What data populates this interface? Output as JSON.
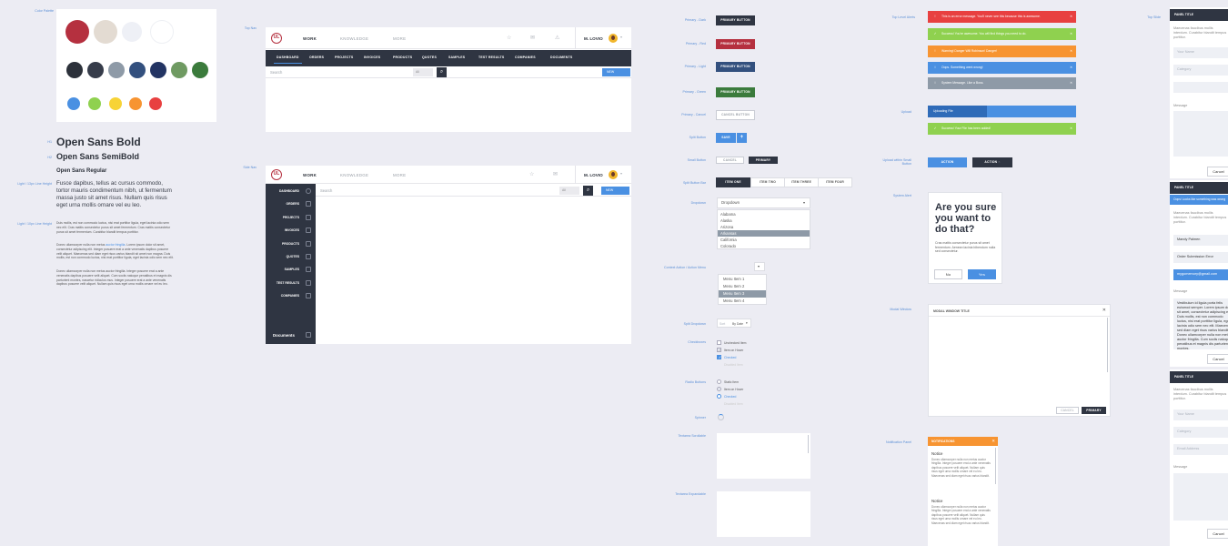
{
  "labels": {
    "color_palette": "Color Palette",
    "h1": "H1",
    "h2": "H2",
    "h3": "",
    "body_large": "Light / 13px Line Height",
    "body_small": "Light / 10px Line Height",
    "top_nav": "Top Nav",
    "side_nav": "Side Nav",
    "primary_dark": "Primary - Dark",
    "primary_red": "Primary - Red",
    "primary_light": "Primary - Light",
    "primary_green": "Primary - Green",
    "primary_cancel": "Primary - Cancel",
    "split_button": "Split Button",
    "small_button": "Small Button",
    "split_button_bar": "Split Button Bar",
    "dropdown": "Dropdown",
    "context_action": "Context Action / Action Menu",
    "split_dropdown": "Split Dropdown",
    "checkboxes": "Checkboxes",
    "radio_buttons": "Radio Buttons",
    "spinner": "Spinner",
    "textarea_scrollable": "Textarea Scrollable",
    "textarea_expandable": "Textarea Expandable",
    "top_level_alerts": "Top Level Alerts",
    "upload": "Upload",
    "upload_within_small_button": "Upload within Small Button",
    "system_alert": "System Alert",
    "modal_window": "Modal Window",
    "notification_panel": "Notification Panel",
    "top_slide": "Top Slide"
  },
  "palette": [
    "#b5303f",
    "#e3dbd2",
    "#eef0f6",
    "#ffffff",
    "#2c313a",
    "#363c4a",
    "#8e9aa7",
    "#33507e",
    "#233463",
    "#6f9a62",
    "#3b7b3c",
    "#4a90e2",
    "#8fd14f",
    "#f7d336",
    "#f79431",
    "#e84040"
  ],
  "typography": {
    "h1": "Open Sans Bold",
    "h2": "Open Sans SemiBold",
    "h3": "Open Sans Regular",
    "para": "Fusce dapibus, tellus ac cursus commodo, tortor mauris condimentum nibh, ut fermentum massa justo sit amet risus. Nullam quis risus eget urna mollis ornare vel eu leo.",
    "small1_a": "Duis mollis, est non commodo luctus, nisi erat porttitor ligula, eget lacinia odio sem nec elit. Cras mattis consectetur purus sit amet fermentum. Cras mattis consectetur purus sit amet fermentum. Curabitur blandit tempus porttitor.",
    "small2_a": "Donec ullamcorper nulla non metus ",
    "small2_link": "auctor fringilla",
    "small2_b": ". Lorem ipsum dolor sit amet, consectetur adipiscing elit. Integer posuere erat a ante venenatis dapibus posuere velit aliquet. Maecenas sed diam eget risus varius blandit sit amet non magna. Duis mollis, est non commodo luctus, nisi erat porttitor ligula, eget lacinia odio sem nec elit.",
    "small3": "Donec ullamcorper nulla non metus auctor fringilla. Integer posuere erat a ante venenatis dapibus posuere velit aliquet. Cum sociis natoque penatibus et magnis dis parturient montes, nascetur ridiculus mus. Integer posuere erat a ante venenatis dapibus posuere velit aliquet. Nullam quis risus eget urna mollis ornare vel eu leo."
  },
  "nav": {
    "logo": "UL",
    "tabs": [
      "WORK",
      "KNOWLEDGE",
      "MORE"
    ],
    "user": "M. LOVIO",
    "subnav": [
      "DASHBOARD",
      "ORDERS",
      "PROJECTS",
      "INVOICES",
      "PRODUCTS",
      "QUOTES",
      "SAMPLES",
      "TEST RESULTS",
      "COMPANIES",
      "DOCUMENTS"
    ],
    "search_placeholder": "Search",
    "search_filter": "All",
    "new_label": "NEW"
  },
  "sidenav": {
    "items": [
      "DASHBOARD",
      "ORDERS",
      "PROJECTS",
      "INVOICES",
      "PRODUCTS",
      "QUOTES",
      "SAMPLES",
      "TEST RESULTS",
      "COMPANIES"
    ],
    "documents": "Documents"
  },
  "buttons": {
    "dark": "PRIMARY BUTTON",
    "red": "PRIMARY BUTTON",
    "light": "PRIMARY BUTTON",
    "green": "PRIMARY BUTTON",
    "cancel": "CANCEL BUTTON",
    "split": "SAVE",
    "small_cancel": "CANCEL",
    "small_primary": "PRIMARY",
    "bar": [
      "ITEM ONE",
      "ITEM TWO",
      "ITEM THREE",
      "ITEM FOUR"
    ]
  },
  "dropdown": {
    "label": "Dropdown",
    "items": [
      "Alabama",
      "Alaska",
      "Arizona",
      "Arkansas",
      "California",
      "Colorado"
    ],
    "selected": 3
  },
  "context_menu": {
    "items": [
      "Menu Item 1",
      "Menu Item 2",
      "Menu Item 3",
      "Menu Item 4"
    ],
    "selected": 2
  },
  "split_dropdown": {
    "prefix": "Sort",
    "value": "By Date"
  },
  "checkboxes": [
    "Unchecked Item",
    "Item on Hover",
    "Checked",
    "Disabled Item"
  ],
  "radios": [
    "Static Item",
    "Item on Hover",
    "Checked",
    "Disabled Item"
  ],
  "alerts": [
    {
      "text": "This is an error message. You'll never see this because this is awesome.",
      "color": "#e84040",
      "icon": "!"
    },
    {
      "text": "Success! You're awesome. You will find things you need to do.",
      "color": "#8fd14f",
      "icon": "✓"
    },
    {
      "text": "Warning! Danger Will Robinson! Danger!",
      "color": "#f79431",
      "icon": "!"
    },
    {
      "text": "Oops. Something went wrong!",
      "color": "#4a90e2",
      "icon": "i"
    },
    {
      "text": "System Message. Like a Boss.",
      "color": "#8e9aa7",
      "icon": "i"
    }
  ],
  "upload": {
    "uploading": "Uploading File",
    "progress": 0.4,
    "success": "Success! Your File has been added!"
  },
  "upload_small": [
    "ACTION",
    "ACTION"
  ],
  "system_alert": {
    "title": "Are you sure you want to do that?",
    "body": "Cras mattis consectetur purus sit amet fermentum. Aenean lacinia bibendum nulla sed consectetur.",
    "no": "No",
    "yes": "Yes"
  },
  "modal": {
    "title": "MODAL WINDOW TITLE",
    "cancel": "CANCEL",
    "primary": "PRIMARY"
  },
  "notification": {
    "title": "NOTIFICATIONS",
    "items": [
      {
        "title": "Notice",
        "body": "Donec ullamcorper nulla non metus auctor fringilla. Integer posuere erat a ante venenatis dapibus posuere velit aliquet. Nullam quis risus eget urna mollis ornare vel eu leo. Maecenas sed diam eget risus varius blandit."
      },
      {
        "title": "Notice",
        "body": "Donec ullamcorper nulla non metus auctor fringilla. Integer posuere erat a ante venenatis dapibus posuere velit aliquet. Nullam quis risus eget urna mollis ornare vel eu leo. Maecenas sed diam eget risus varius blandit."
      }
    ]
  },
  "panels": [
    {
      "title": "PANEL TITLE",
      "intro": "Maecenas faucibus mollis interdum. Curabitur blandit tempus porttitor.",
      "f1": "Your Name",
      "f2": "Category",
      "f3": "",
      "message": "Message",
      "cancel": "Cancel"
    },
    {
      "title": "PANEL TITLE",
      "error": "Oops! Looks like something was wrong",
      "intro": "Maecenas faucibus mollis interdum. Curabitur blandit tempus porttitor.",
      "f1": "Mandy Palmen",
      "f2": "Order Submission Error",
      "f3": "mygomemory@gmail.com",
      "message": "Message",
      "msgtext": "Vestibulum id ligula porta felis euismod semper. Lorem ipsum dolor sit amet, consectetur adipiscing elit. Duis mollis, est non commodo luctus, nisi erat porttitor ligula, eget lacinia odio sem nec elit. Maecenas sed diam eget risus varius blandit. Donec ullamcorper nulla non metus auctor fringilla. Cum sociis natoque penatibus et magnis dis parturient montes.",
      "cancel": "Cancel"
    },
    {
      "title": "PANEL TITLE",
      "intro": "Maecenas faucibus mollis interdum. Curabitur blandit tempus porttitor.",
      "f1": "Your Name",
      "f2": "Category",
      "f3": "Email Address",
      "message": "Message",
      "cancel": "Cancel"
    }
  ]
}
